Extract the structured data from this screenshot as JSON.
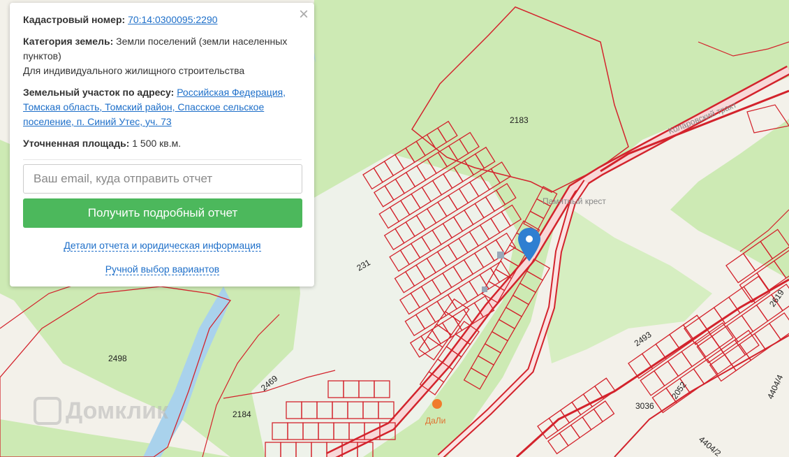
{
  "popup": {
    "cadastral_label": "Кадастровый номер:",
    "cadastral_value": "70:14:0300095:2290",
    "category_label": "Категория земель:",
    "category_value": "Земли поселений (земли населенных пунктов)",
    "category_use": "Для индивидуального жилищного строительства",
    "address_label": "Земельный участок по адресу:",
    "address_value": "Российская Федерация, Томская область, Томский район, Спасское сельское поселение, п. Синий Утес, уч. 73",
    "area_label": "Уточненная площадь:",
    "area_value": "1 500 кв.м.",
    "email_placeholder": "Ваш email, куда отправить отчет",
    "report_button": "Получить подробный отчет",
    "details_link": "Детали отчета и юридическая информация",
    "manual_link": "Ручной выбор вариантов",
    "close_icon": "×"
  },
  "map": {
    "parcel_labels": [
      "2183",
      "2498",
      "2184",
      "2469",
      "2493",
      "3036",
      "2052",
      "4404/2",
      "2619",
      "4404/4",
      "231"
    ],
    "poi_memorial": "Памятный крест",
    "poi_dali": "ДаЛи",
    "road_tract": "Коларовский тракт",
    "colors": {
      "forest": "#cdeab4",
      "background": "#f3f1ea",
      "parcel_stroke": "#d3232c",
      "water": "#a9d2ec",
      "road": "#ffffff",
      "marker": "#2f7fd1",
      "button": "#4cb85c"
    }
  },
  "watermark": "Домклик"
}
